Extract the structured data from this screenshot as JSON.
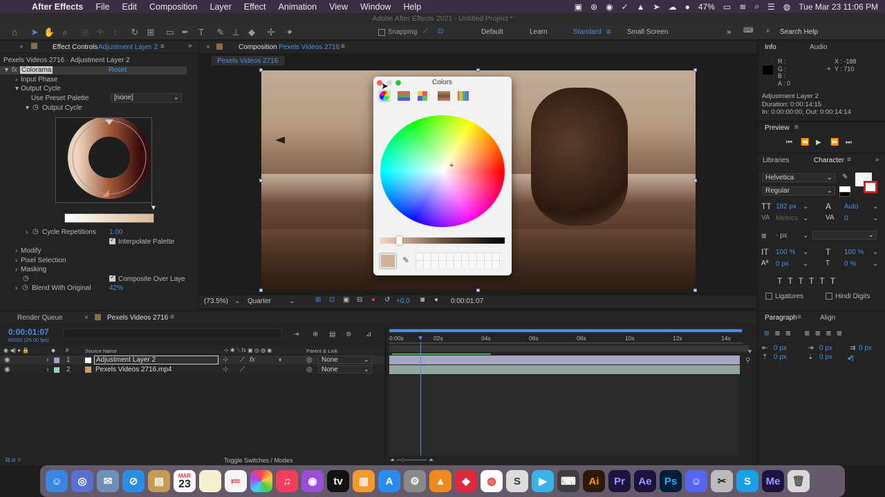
{
  "menubar": {
    "app": "After Effects",
    "items": [
      "File",
      "Edit",
      "Composition",
      "Layer",
      "Effect",
      "Animation",
      "View",
      "Window",
      "Help"
    ],
    "battery": "47%",
    "datetime": "Tue Mar 23  11:06 PM"
  },
  "titlebar": {
    "title": "Adobe After Effects 2021 - Untitled Project *"
  },
  "toolbar": {
    "snapping": "Snapping",
    "workspaces": [
      "Default",
      "Learn",
      "Standard",
      "Small Screen"
    ],
    "search": "Search Help"
  },
  "effect_controls": {
    "tab": "Effect Controls",
    "layer": "Adjustment Layer 2",
    "header": "Pexels Videos 2716 · Adjustment Layer 2",
    "fx_name": "Colorama",
    "reset": "Reset",
    "input_phase": "Input Phase",
    "output_cycle": "Output Cycle",
    "use_preset_label": "Use Preset Palette",
    "use_preset_value": "[none]",
    "output_cycle_sub": "Output Cycle",
    "cycle_rep_label": "Cycle Repetitions",
    "cycle_rep_value": "1.00",
    "interpolate": "Interpolate Palette",
    "modify": "Modify",
    "pixel_selection": "Pixel Selection",
    "masking": "Masking",
    "composite": "Composite Over Laye",
    "blend_label": "Blend With Original",
    "blend_value": "42%"
  },
  "composition": {
    "tab": "Composition",
    "name": "Pexels Videos 2716",
    "subtab": "Pexels Videos 2716",
    "zoom": "(73.5%)",
    "quality": "Quarter",
    "exposure": "+0.0",
    "timecode": "0:00:01:07"
  },
  "colors_dialog": {
    "title": "Colors"
  },
  "info": {
    "tab": "Info",
    "audio_tab": "Audio",
    "r": "R :",
    "g": "G :",
    "b": "B :",
    "a": "A :  0",
    "x": "X : -188",
    "y": "Y : 710",
    "layer": "Adjustment Layer 2",
    "duration": "Duration: 0:00:14:15",
    "inout": "In: 0:00:00:00, Out: 0:00:14:14"
  },
  "preview": {
    "tab": "Preview"
  },
  "character": {
    "libraries": "Libraries",
    "tab": "Character",
    "font": "Helvetica",
    "style": "Regular",
    "size": "182 px",
    "leading": "Auto",
    "kerning": "Metrics",
    "tracking": "0",
    "stroke": "- px",
    "vscale": "100 %",
    "hscale": "100 %",
    "baseline": "0 px",
    "tsume": "0 %",
    "ligatures": "Ligatures",
    "hindi": "Hindi Digits"
  },
  "paragraph": {
    "tab": "Paragraph",
    "align": "Align",
    "vals": [
      "0 px",
      "0 px",
      "0 px",
      "0 px",
      "0 px"
    ]
  },
  "timeline": {
    "render_queue": "Render Queue",
    "comp_tab": "Pexels Videos 2716",
    "timecode": "0:00:01:07",
    "fps": "00032 (25.00 fps)",
    "col_source": "Source Name",
    "col_parent": "Parent & Link",
    "layers": [
      {
        "num": "1",
        "name": "Adjustment Layer 2",
        "parent": "None"
      },
      {
        "num": "2",
        "name": "Pexels Videos 2716.mp4",
        "parent": "None"
      }
    ],
    "ruler": [
      "0:00s",
      "02s",
      "04s",
      "06s",
      "08s",
      "10s",
      "12s",
      "14s"
    ],
    "toggle": "Toggle Switches / Modes"
  },
  "dock": {
    "calendar_month": "MAR",
    "calendar_day": "23"
  }
}
